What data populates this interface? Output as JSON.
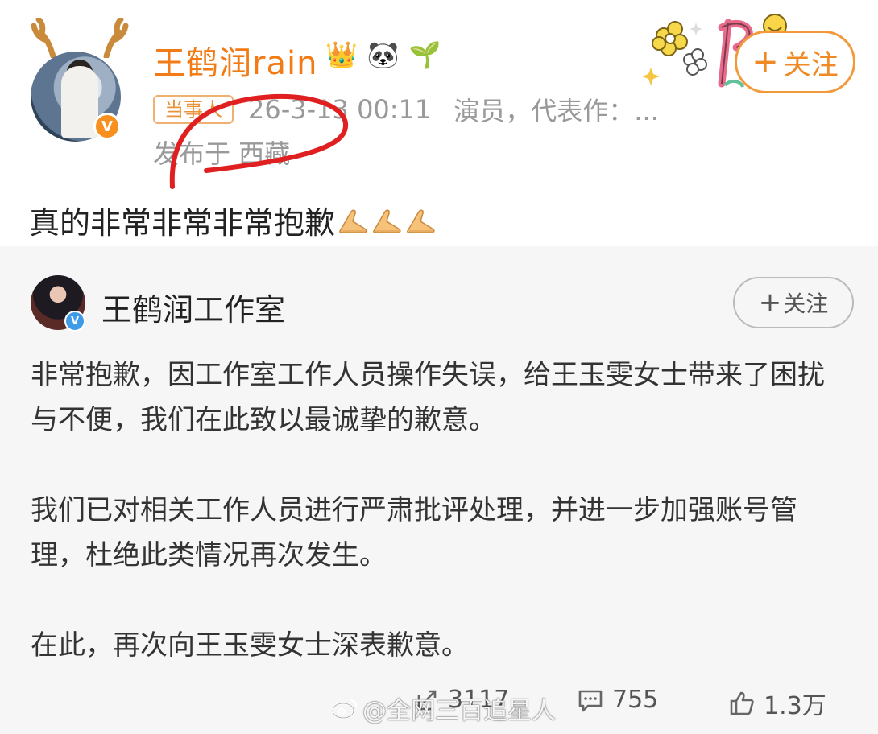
{
  "post": {
    "username": "王鹤润rain",
    "badges": [
      "👑",
      "🐼",
      "🌱"
    ],
    "tag": "当事人",
    "timestamp": "26-3-13 00:11",
    "role": "演员，代表作：...",
    "location": "发布于 西藏",
    "follow_label": "关注",
    "text": "真的非常非常非常抱歉",
    "verified_badge": "V"
  },
  "repost": {
    "author": "王鹤润工作室",
    "follow_label": "关注",
    "verified_badge": "V",
    "paragraphs": [
      "非常抱歉，因工作室工作人员操作失误，给王玉雯女士带来了困扰与不便，我们在此致以最诚挚的歉意。",
      "我们已对相关工作人员进行严肃批评处理，并进一步加强账号管理，杜绝此类情况再次发生。",
      "在此，再次向王玉雯女士深表歉意。"
    ],
    "actions": {
      "reposts": "3117",
      "comments": "755",
      "likes": "1.3万"
    }
  },
  "watermark": "@全网三百追星人",
  "colors": {
    "accent_orange": "#f27b16",
    "annotation_red": "#e02020",
    "repost_bg": "#f6f6f6"
  }
}
